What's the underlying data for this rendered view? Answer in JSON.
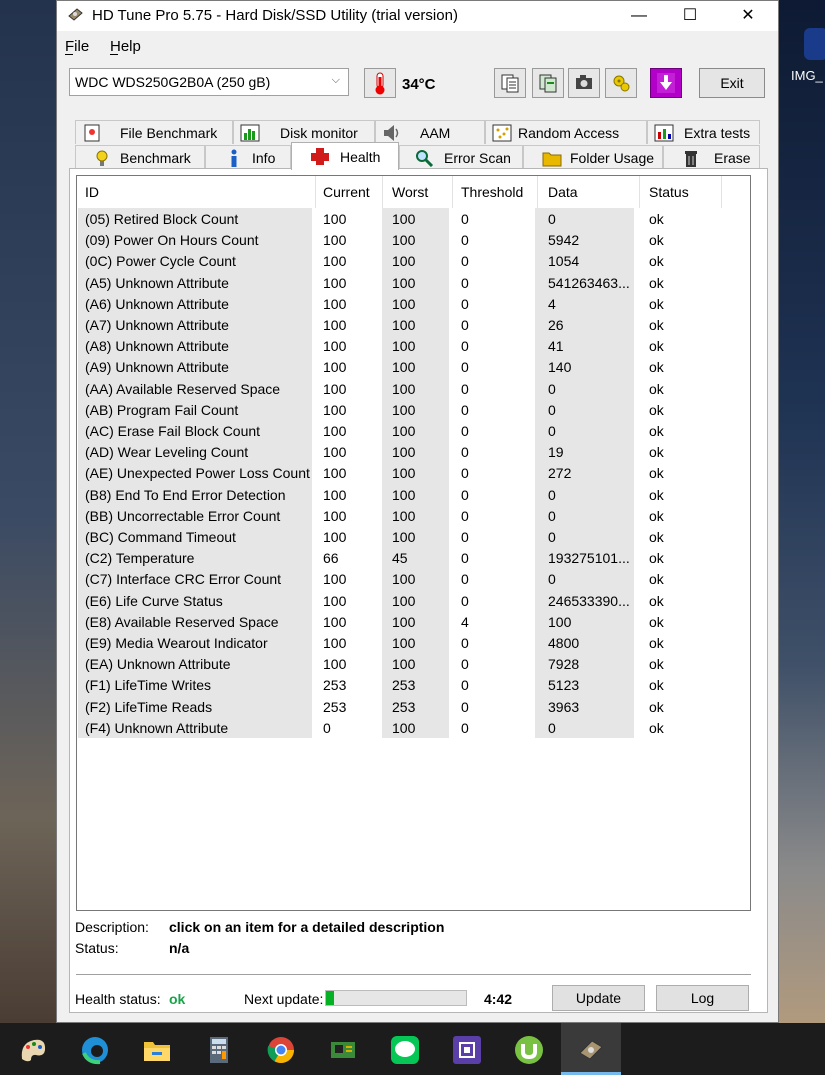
{
  "window": {
    "title": "HD Tune Pro 5.75 - Hard Disk/SSD Utility (trial version)",
    "minimize": "—",
    "maximize": "☐",
    "close": "✕"
  },
  "menu": {
    "file": "File",
    "help": "Help"
  },
  "toolbar": {
    "drive": "WDC WDS250G2B0A (250 gB)",
    "temperature": "34°C",
    "exit_label": "Exit"
  },
  "tabs_top": [
    {
      "label": "File Benchmark",
      "icon": "file-benchmark-icon"
    },
    {
      "label": "Disk monitor",
      "icon": "disk-monitor-icon"
    },
    {
      "label": "AAM",
      "icon": "speaker-icon"
    },
    {
      "label": "Random Access",
      "icon": "random-access-icon"
    },
    {
      "label": "Extra tests",
      "icon": "extra-tests-icon"
    }
  ],
  "tabs_bottom": [
    {
      "label": "Benchmark",
      "icon": "lightbulb-icon"
    },
    {
      "label": "Info",
      "icon": "info-icon"
    },
    {
      "label": "Health",
      "icon": "health-cross-icon",
      "active": true
    },
    {
      "label": "Error Scan",
      "icon": "magnifier-icon"
    },
    {
      "label": "Folder Usage",
      "icon": "folder-icon"
    },
    {
      "label": "Erase",
      "icon": "trash-icon"
    }
  ],
  "table": {
    "headers": [
      "ID",
      "Current",
      "Worst",
      "Threshold",
      "Data",
      "Status"
    ],
    "rows": [
      [
        "(05) Retired Block Count",
        "100",
        "100",
        "0",
        "0",
        "ok"
      ],
      [
        "(09) Power On Hours Count",
        "100",
        "100",
        "0",
        "5942",
        "ok"
      ],
      [
        "(0C) Power Cycle Count",
        "100",
        "100",
        "0",
        "1054",
        "ok"
      ],
      [
        "(A5) Unknown Attribute",
        "100",
        "100",
        "0",
        "541263463...",
        "ok"
      ],
      [
        "(A6) Unknown Attribute",
        "100",
        "100",
        "0",
        "4",
        "ok"
      ],
      [
        "(A7) Unknown Attribute",
        "100",
        "100",
        "0",
        "26",
        "ok"
      ],
      [
        "(A8) Unknown Attribute",
        "100",
        "100",
        "0",
        "41",
        "ok"
      ],
      [
        "(A9) Unknown Attribute",
        "100",
        "100",
        "0",
        "140",
        "ok"
      ],
      [
        "(AA) Available Reserved Space",
        "100",
        "100",
        "0",
        "0",
        "ok"
      ],
      [
        "(AB) Program Fail Count",
        "100",
        "100",
        "0",
        "0",
        "ok"
      ],
      [
        "(AC) Erase Fail Block Count",
        "100",
        "100",
        "0",
        "0",
        "ok"
      ],
      [
        "(AD) Wear Leveling Count",
        "100",
        "100",
        "0",
        "19",
        "ok"
      ],
      [
        "(AE) Unexpected Power Loss Count",
        "100",
        "100",
        "0",
        "272",
        "ok"
      ],
      [
        "(B8) End To End Error Detection",
        "100",
        "100",
        "0",
        "0",
        "ok"
      ],
      [
        "(BB) Uncorrectable Error Count",
        "100",
        "100",
        "0",
        "0",
        "ok"
      ],
      [
        "(BC) Command Timeout",
        "100",
        "100",
        "0",
        "0",
        "ok"
      ],
      [
        "(C2) Temperature",
        "66",
        "45",
        "0",
        "193275101...",
        "ok"
      ],
      [
        "(C7) Interface CRC Error Count",
        "100",
        "100",
        "0",
        "0",
        "ok"
      ],
      [
        "(E6) Life Curve Status",
        "100",
        "100",
        "0",
        "246533390...",
        "ok"
      ],
      [
        "(E8) Available Reserved Space",
        "100",
        "100",
        "4",
        "100",
        "ok"
      ],
      [
        "(E9) Media Wearout Indicator",
        "100",
        "100",
        "0",
        "4800",
        "ok"
      ],
      [
        "(EA) Unknown Attribute",
        "100",
        "100",
        "0",
        "7928",
        "ok"
      ],
      [
        "(F1) LifeTime Writes",
        "253",
        "253",
        "0",
        "5123",
        "ok"
      ],
      [
        "(F2) LifeTime Reads",
        "253",
        "253",
        "0",
        "3963",
        "ok"
      ],
      [
        "(F4) Unknown Attribute",
        "0",
        "100",
        "0",
        "0",
        "ok"
      ]
    ]
  },
  "description": {
    "desc_label": "Description:",
    "desc_value": "click on an item for a detailed description",
    "status_label": "Status:",
    "status_value": "n/a"
  },
  "footer": {
    "health_label": "Health status:",
    "health_value": "ok",
    "health_color": "#1aa34a",
    "next_update_label": "Next update:",
    "progress_fraction": 0.06,
    "countdown": "4:42",
    "update_button": "Update",
    "log_button": "Log"
  },
  "desktop": {
    "icon_label": "IMG_"
  },
  "taskbar": {
    "icons": [
      "paint-icon",
      "edge-icon",
      "file-explorer-icon",
      "calculator-icon",
      "chrome-icon",
      "network-card-icon",
      "line-icon",
      "processor-icon",
      "utorrent-icon",
      "hdtune-icon"
    ]
  }
}
